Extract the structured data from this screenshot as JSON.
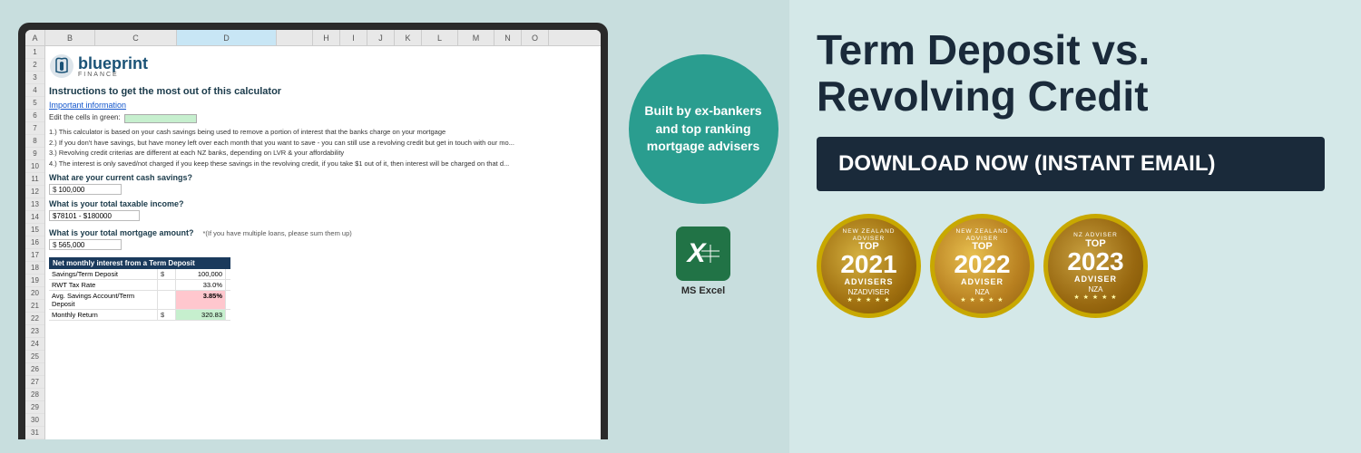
{
  "left": {
    "logo": {
      "main": "blueprint",
      "sub": "FINANCE"
    },
    "instructions_title": "Instructions to get the most out of this calculator",
    "important_link": "Important information",
    "edit_cells_label": "Edit the cells in green:",
    "instructions": [
      "1.) This calculator is based on your cash savings being used to remove a portion of interest that the banks charge on your mortgage",
      "2.) If you don't have savings, but have money left over each month that you want to save - you can still use a revolving credit but get in touch with our mo...",
      "3.) Revolving credit criterias are different at each NZ banks, depending on LVR & your affordability",
      "4.) The interest is only saved/not charged if you keep these savings in the revolving credit, if you take $1 out of it, then interest will be charged on that d..."
    ],
    "questions": [
      {
        "label": "What are your current cash savings?",
        "value": "100,000"
      },
      {
        "label": "What is your total taxable income?",
        "value": "$78101 - $180000"
      },
      {
        "label": "What is your total mortgage amount?",
        "value": "565,000",
        "note": "*(If you have multiple loans, please sum them up)"
      }
    ],
    "table": {
      "header": "Net monthly interest from a Term Deposit",
      "rows": [
        {
          "label": "Savings/Term Deposit",
          "dollar": "$",
          "value": "100,000",
          "highlight": ""
        },
        {
          "label": "RWT Tax Rate",
          "dollar": "",
          "value": "33.0%",
          "highlight": ""
        },
        {
          "label": "Avg. Savings Account/Term Deposit",
          "dollar": "",
          "value": "3.85%",
          "highlight": "red"
        },
        {
          "label": "Monthly Return",
          "dollar": "$",
          "value": "320.83",
          "highlight": "green"
        }
      ]
    }
  },
  "center": {
    "circle_text": "Built by ex-bankers and top ranking mortgage advisers",
    "excel_label": "MS Excel",
    "excel_symbol": "X"
  },
  "right": {
    "title_line1": "Term Deposit vs.",
    "title_line2": "Revolving Credit",
    "download_bold": "DOWNLOAD NOW",
    "download_normal": " (INSTANT EMAIL)",
    "badges": [
      {
        "id": "badge-2021",
        "arc_top": "NEW ZEALAND ADVISER",
        "top_label": "TOP",
        "year": "2021",
        "adviser": "ADVISERS",
        "nza": "NZADVISER",
        "stars": "★ ★ ★ ★ ★"
      },
      {
        "id": "badge-2022",
        "arc_top": "NEW ZEALAND ADVISER",
        "top_label": "TOP",
        "year": "2022",
        "adviser": "ADVISER",
        "nza": "NZA",
        "stars": "★ ★ ★ ★ ★"
      },
      {
        "id": "badge-2023",
        "arc_top": "NZ ADVISER",
        "top_label": "TOP",
        "year": "2023",
        "adviser": "ADVISER",
        "nza": "NZA",
        "stars": "★ ★ ★ ★ ★"
      }
    ]
  }
}
